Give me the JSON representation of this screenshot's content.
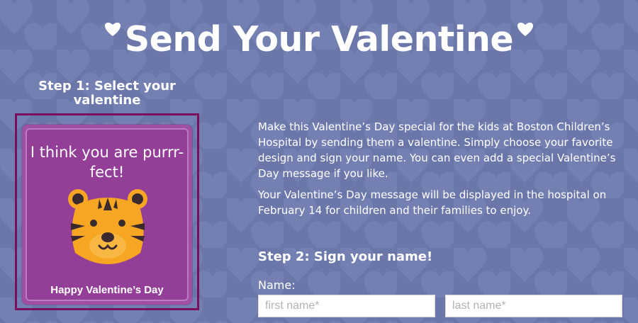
{
  "title": "Send Your Valentine",
  "step1": {
    "heading": "Step 1: Select your valentine"
  },
  "card": {
    "message": "I think you are purrr-fect!",
    "greeting": "Happy Valentine’s Day",
    "illustration": "tiger-face-icon"
  },
  "description": {
    "paragraph1": "Make this Valentine’s Day special for the kids at Boston Children’s Hospital by sending them a valentine. Simply choose your favorite design and sign your name. You can even add a special Valentine’s Day message if you like.",
    "paragraph2": "Your Valentine’s Day message will be displayed in the hospital on February 14 for children and their families to enjoy."
  },
  "step2": {
    "heading": "Step 2: Sign your name!",
    "name_label": "Name:",
    "first_name_placeholder": "first name*",
    "last_name_placeholder": "last name*",
    "first_name_value": "",
    "last_name_value": ""
  },
  "colors": {
    "background": "#6b77a8",
    "card": "#933f98",
    "selection_border": "#7a0f5e",
    "tiger": "#f6a623"
  }
}
